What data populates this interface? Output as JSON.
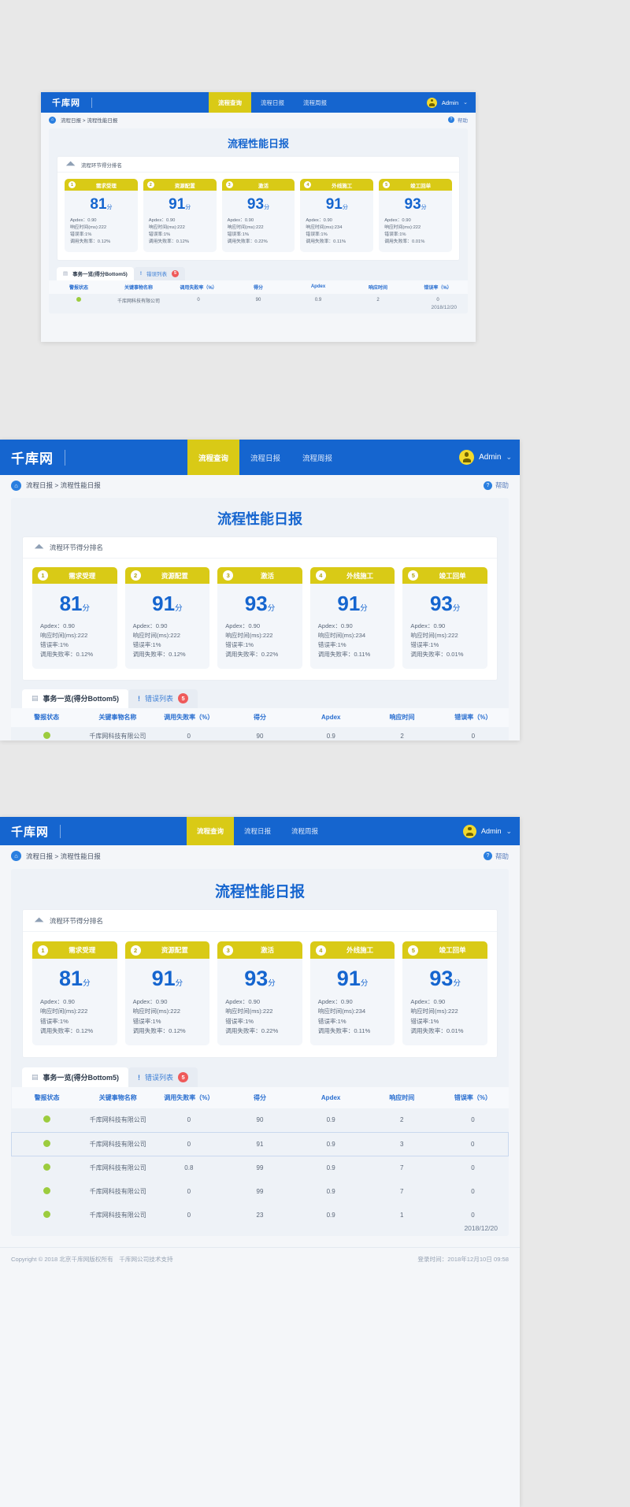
{
  "brand": {
    "logo_text": "千库网",
    "accent_blue": "#1565cf",
    "accent_yellow": "#d9ca16"
  },
  "navbar": {
    "tabs": [
      {
        "label": "流程查询",
        "active": true
      },
      {
        "label": "流程日报",
        "active": false
      },
      {
        "label": "流程周报",
        "active": false
      }
    ],
    "user": {
      "name": "Admin",
      "avatar_icon": "user-icon",
      "chevron": "⌄"
    }
  },
  "breadcrumb": {
    "home_icon": "home-icon",
    "text": "流程日报 > 流程性能日报",
    "help_icon": "question-icon",
    "help_label": "帮助"
  },
  "page": {
    "title": "流程性能日报",
    "date": "2018/12/20"
  },
  "ranking_section": {
    "icon": "ranking-icon",
    "title": "流程环节得分排名",
    "cards": [
      {
        "rank": "1",
        "name": "需求受理",
        "score": "81",
        "unit": "分",
        "apdex": "Apdex：0.90",
        "response": "响应时间(ms):222",
        "error": "错误率:1%",
        "fail": "调用失败率：0.12%"
      },
      {
        "rank": "2",
        "name": "资源配置",
        "score": "91",
        "unit": "分",
        "apdex": "Apdex：0.90",
        "response": "响应时间(ms):222",
        "error": "错误率:1%",
        "fail": "调用失败率：0.12%"
      },
      {
        "rank": "3",
        "name": "激活",
        "score": "93",
        "unit": "分",
        "apdex": "Apdex：0.90",
        "response": "响应时间(ms):222",
        "error": "错误率:1%",
        "fail": "调用失败率：0.22%"
      },
      {
        "rank": "4",
        "name": "外线施工",
        "score": "91",
        "unit": "分",
        "apdex": "Apdex：0.90",
        "response": "响应时间(ms):234",
        "error": "错误率:1%",
        "fail": "调用失败率：0.11%"
      },
      {
        "rank": "5",
        "name": "竣工回单",
        "score": "93",
        "unit": "分",
        "apdex": "Apdex：0.90",
        "response": "响应时间(ms):222",
        "error": "错误率:1%",
        "fail": "调用失败率：0.01%"
      }
    ]
  },
  "list_section": {
    "tabs": [
      {
        "icon": "list-icon",
        "label": "事务一览(得分Bottom5)",
        "active": true,
        "badge": ""
      },
      {
        "icon": "exclamation-icon",
        "label": "错误列表",
        "active": false,
        "badge": "5"
      }
    ],
    "table": {
      "columns": [
        "警报状态",
        "关键事物名称",
        "调用失败率（%）",
        "得分",
        "Apdex",
        "响应时间",
        "错误率（%）"
      ],
      "rows": [
        {
          "status": "green",
          "name": "千库网科技有限公司",
          "fail_rate": "0",
          "score": "90",
          "apdex": "0.9",
          "response": "2",
          "error_rate": "0",
          "selected": false
        },
        {
          "status": "green",
          "name": "千库网科技有限公司",
          "fail_rate": "0",
          "score": "91",
          "apdex": "0.9",
          "response": "3",
          "error_rate": "0",
          "selected": true
        },
        {
          "status": "green",
          "name": "千库网科技有限公司",
          "fail_rate": "0.8",
          "score": "99",
          "apdex": "0.9",
          "response": "7",
          "error_rate": "0",
          "selected": false
        },
        {
          "status": "green",
          "name": "千库网科技有限公司",
          "fail_rate": "0",
          "score": "99",
          "apdex": "0.9",
          "response": "7",
          "error_rate": "0",
          "selected": false
        },
        {
          "status": "green",
          "name": "千库网科技有限公司",
          "fail_rate": "0",
          "score": "23",
          "apdex": "0.9",
          "response": "1",
          "error_rate": "0",
          "selected": false
        }
      ]
    }
  },
  "footer": {
    "copyright": "Copyright © 2018 北京千库网版权所有　千库网公司技术支持",
    "login_time": "登录时间：2018年12月10日  09:58"
  }
}
